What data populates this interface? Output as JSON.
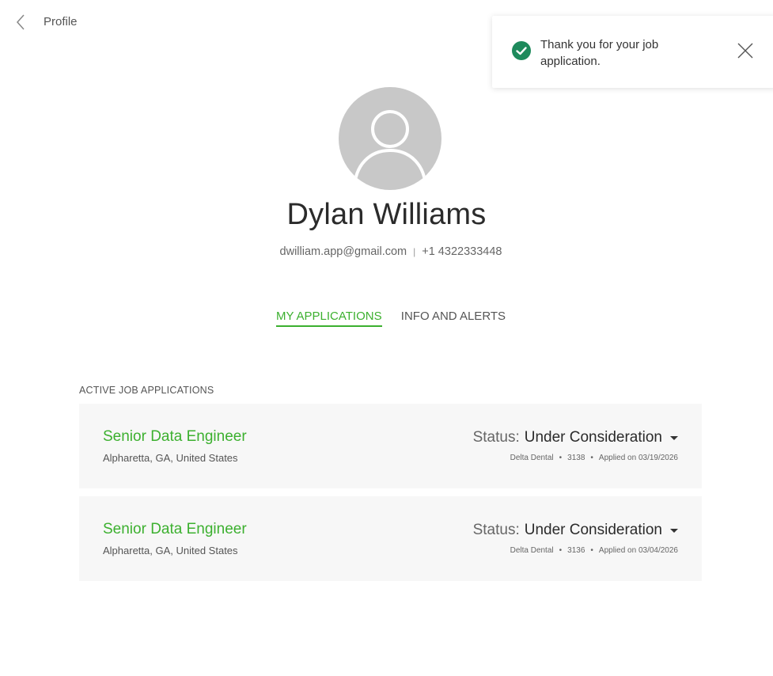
{
  "header": {
    "title": "Profile"
  },
  "toast": {
    "message": "Thank you for your job application."
  },
  "profile": {
    "name": "Dylan Williams",
    "email": "dwilliam.app@gmail.com",
    "separator": "|",
    "phone": "+1 4322333448"
  },
  "tabs": [
    {
      "label": "MY APPLICATIONS",
      "active": true
    },
    {
      "label": "INFO AND ALERTS",
      "active": false
    }
  ],
  "section": {
    "label": "ACTIVE JOB APPLICATIONS"
  },
  "applications": [
    {
      "title": "Senior Data Engineer",
      "location": "Alpharetta, GA, United States",
      "status_label": "Status:",
      "status_value": "Under Consideration",
      "company": "Delta Dental",
      "id": "3138",
      "applied": "Applied on 03/19/2026"
    },
    {
      "title": "Senior Data Engineer",
      "location": "Alpharetta, GA, United States",
      "status_label": "Status:",
      "status_value": "Under Consideration",
      "company": "Delta Dental",
      "id": "3136",
      "applied": "Applied on 03/04/2026"
    }
  ],
  "colors": {
    "accent": "#3cb02f",
    "success": "#1e8a5c",
    "card_bg": "#f7f7f7",
    "avatar_bg": "#c8c8c8"
  },
  "icons": {
    "back": "chevron-left-icon",
    "success": "check-circle-icon",
    "close": "close-icon",
    "avatar": "user-silhouette-icon",
    "dropdown": "caret-down-icon"
  }
}
